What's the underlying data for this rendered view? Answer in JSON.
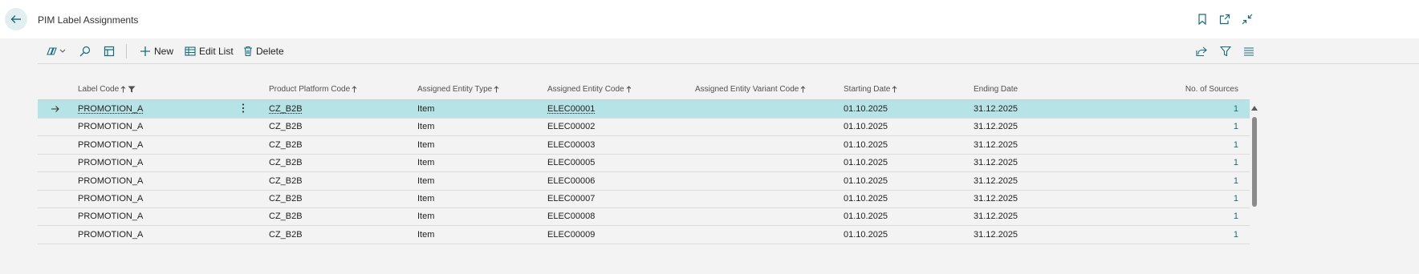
{
  "header": {
    "title": "PIM Label Assignments"
  },
  "actions": {
    "new_label": "New",
    "edit_list_label": "Edit List",
    "delete_label": "Delete"
  },
  "columns": [
    "Label Code",
    "Product Platform Code",
    "Assigned Entity Type",
    "Assigned Entity Code",
    "Assigned Entity Variant Code",
    "Starting Date",
    "Ending Date",
    "No. of Sources"
  ],
  "rows": [
    {
      "label_code": "PROMOTION_A",
      "platform": "CZ_B2B",
      "entity_type": "Item",
      "entity_code": "ELEC00001",
      "variant": "",
      "start": "01.10.2025",
      "end": "31.12.2025",
      "sources": "1"
    },
    {
      "label_code": "PROMOTION_A",
      "platform": "CZ_B2B",
      "entity_type": "Item",
      "entity_code": "ELEC00002",
      "variant": "",
      "start": "01.10.2025",
      "end": "31.12.2025",
      "sources": "1"
    },
    {
      "label_code": "PROMOTION_A",
      "platform": "CZ_B2B",
      "entity_type": "Item",
      "entity_code": "ELEC00003",
      "variant": "",
      "start": "01.10.2025",
      "end": "31.12.2025",
      "sources": "1"
    },
    {
      "label_code": "PROMOTION_A",
      "platform": "CZ_B2B",
      "entity_type": "Item",
      "entity_code": "ELEC00005",
      "variant": "",
      "start": "01.10.2025",
      "end": "31.12.2025",
      "sources": "1"
    },
    {
      "label_code": "PROMOTION_A",
      "platform": "CZ_B2B",
      "entity_type": "Item",
      "entity_code": "ELEC00006",
      "variant": "",
      "start": "01.10.2025",
      "end": "31.12.2025",
      "sources": "1"
    },
    {
      "label_code": "PROMOTION_A",
      "platform": "CZ_B2B",
      "entity_type": "Item",
      "entity_code": "ELEC00007",
      "variant": "",
      "start": "01.10.2025",
      "end": "31.12.2025",
      "sources": "1"
    },
    {
      "label_code": "PROMOTION_A",
      "platform": "CZ_B2B",
      "entity_type": "Item",
      "entity_code": "ELEC00008",
      "variant": "",
      "start": "01.10.2025",
      "end": "31.12.2025",
      "sources": "1"
    },
    {
      "label_code": "PROMOTION_A",
      "platform": "CZ_B2B",
      "entity_type": "Item",
      "entity_code": "ELEC00009",
      "variant": "",
      "start": "01.10.2025",
      "end": "31.12.2025",
      "sources": "1"
    }
  ],
  "selected_row": 0,
  "colors": {
    "accent": "#1a6b7a",
    "selected_row": "#b6e3e6",
    "background": "#f3f3f3"
  },
  "icons": {
    "back": "arrow-left-icon",
    "bookmark": "bookmark-icon",
    "open_new": "open-in-new-window-icon",
    "collapse": "collapse-icon",
    "copilot": "copilot-icon",
    "search": "search-icon",
    "layout": "layout-icon",
    "new": "plus-icon",
    "edit_list": "edit-list-icon",
    "delete": "trash-icon",
    "share": "share-icon",
    "filter": "filter-icon",
    "list_view": "list-view-icon",
    "sort": "sort-arrow-icon",
    "row_arrow": "row-pointer-icon",
    "row_menu": "more-options-icon"
  }
}
